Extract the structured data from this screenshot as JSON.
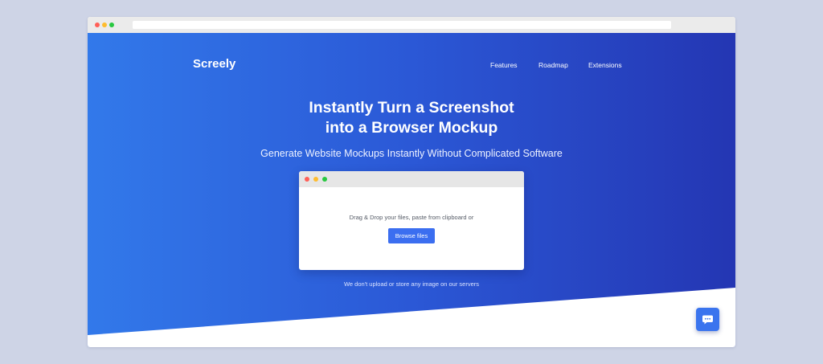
{
  "brand": {
    "name": "Screely"
  },
  "nav": {
    "items": [
      {
        "label": "Features"
      },
      {
        "label": "Roadmap"
      },
      {
        "label": "Extensions"
      }
    ]
  },
  "hero": {
    "headline_line1": "Instantly Turn a Screenshot",
    "headline_line2": "into a Browser Mockup",
    "subheadline": "Generate Website Mockups Instantly Without Complicated Software"
  },
  "dropzone": {
    "instruction": "Drag & Drop your files, paste from clipboard or",
    "button_label": "Browse files"
  },
  "privacy_note": "We don't upload or store any image on our servers",
  "icons": {
    "chat": "chat-bubble-icon",
    "window_controls": [
      "close-dot",
      "minimize-dot",
      "maximize-dot"
    ]
  },
  "colors": {
    "page_background": "#ced4e6",
    "gradient_start": "#3279ea",
    "gradient_end": "#2436b3",
    "button_primary": "#3b6ef0",
    "traffic_red": "#ff5f57",
    "traffic_yellow": "#febc2e",
    "traffic_green": "#28c840"
  }
}
